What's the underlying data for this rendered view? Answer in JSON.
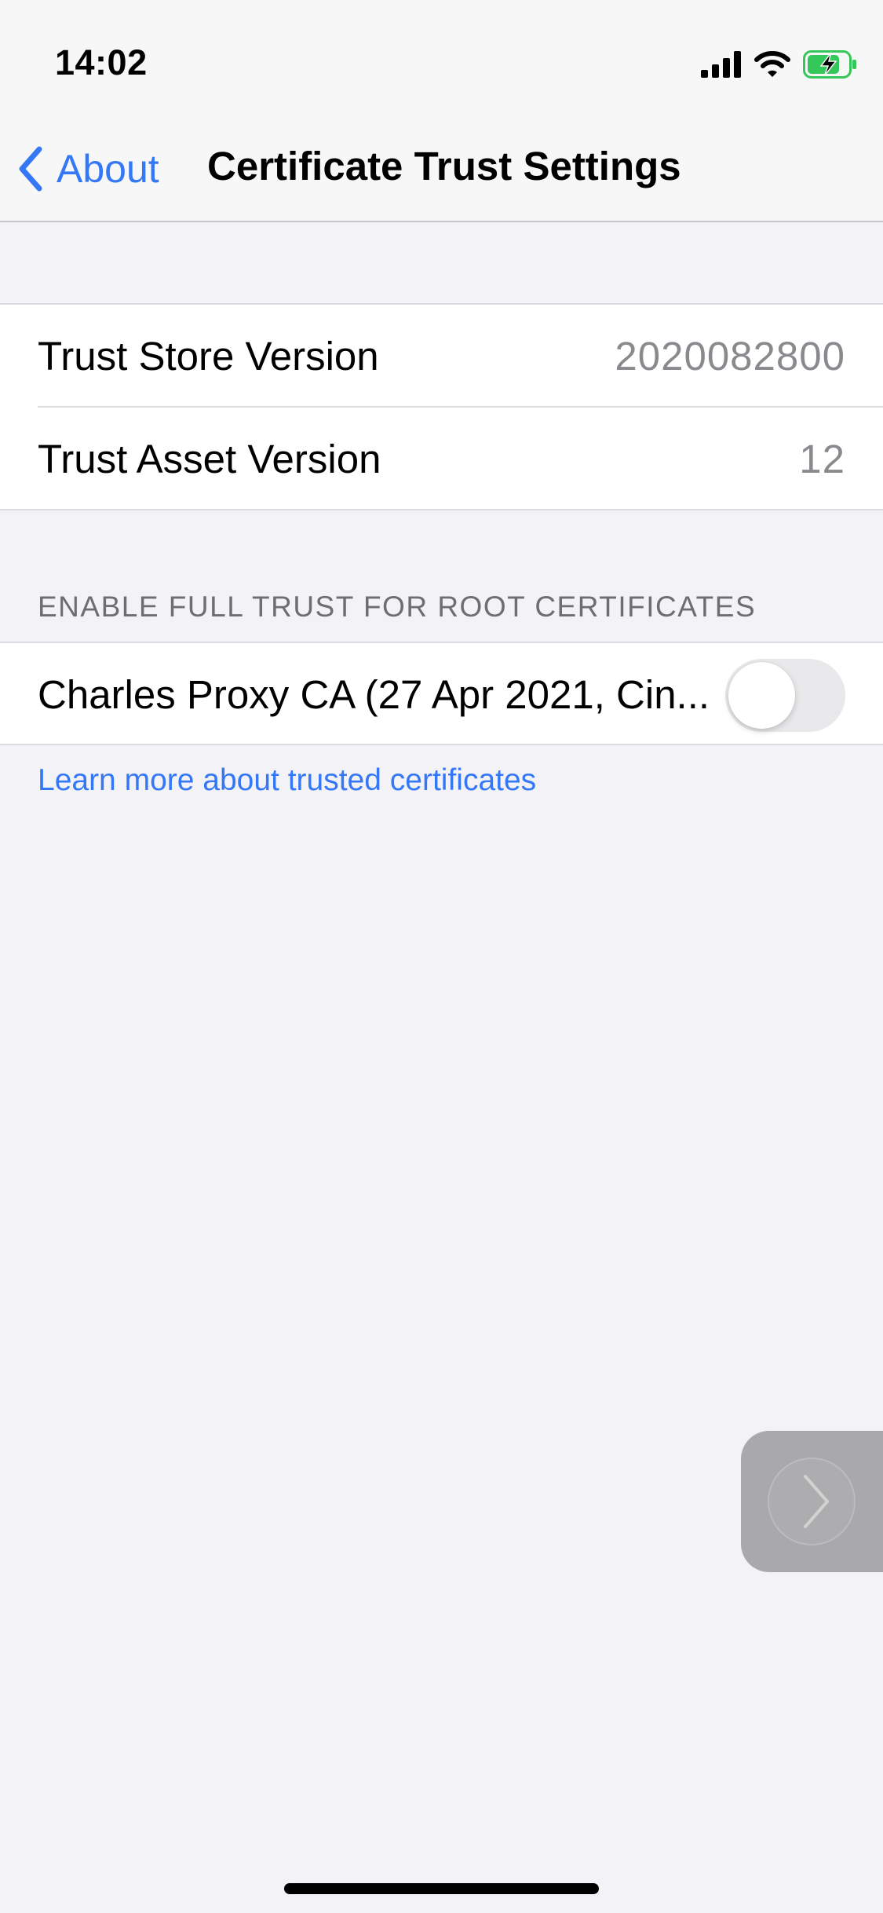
{
  "status_bar": {
    "time": "14:02",
    "icons": [
      "signal-icon",
      "wifi-icon",
      "battery-charging-icon"
    ],
    "battery_color": "#34c759"
  },
  "nav": {
    "back_label": "About",
    "title": "Certificate Trust Settings",
    "accent_color": "#3478f6"
  },
  "versions": {
    "items": [
      {
        "label": "Trust Store Version",
        "value": "2020082800"
      },
      {
        "label": "Trust Asset Version",
        "value": "12"
      }
    ]
  },
  "root_certificates": {
    "header": "ENABLE FULL TRUST FOR ROOT CERTIFICATES",
    "items": [
      {
        "label": "Charles Proxy CA (27 Apr 2021, Cin...",
        "enabled": false
      }
    ]
  },
  "footer": {
    "learn_more_link": "Learn more about trusted certificates"
  }
}
